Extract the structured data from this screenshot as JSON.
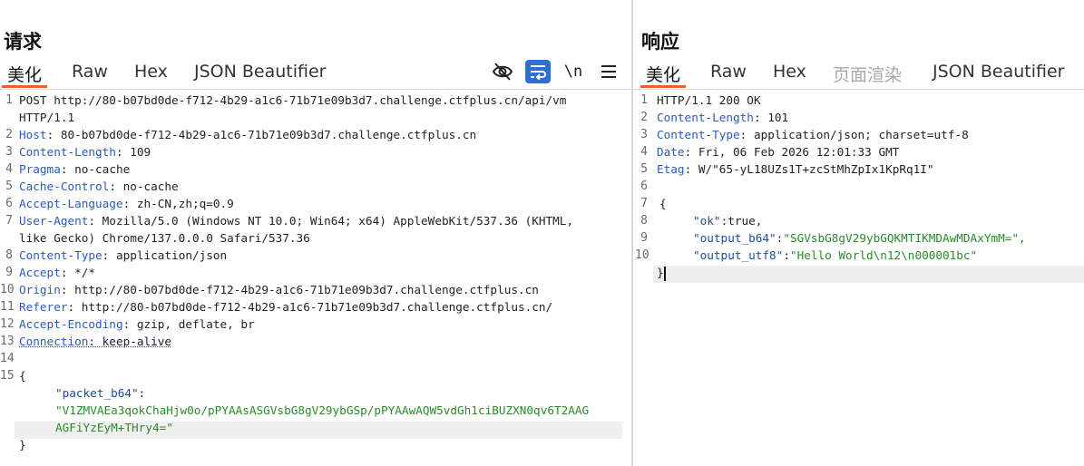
{
  "request": {
    "title": "请求",
    "tabs": [
      "美化",
      "Raw",
      "Hex",
      "JSON Beautifier"
    ],
    "active_tab": "美化",
    "toolbar": {
      "newline_label": "\\n"
    },
    "gutter": [
      "1",
      "2",
      "3",
      "4",
      "5",
      "6",
      "7",
      "8",
      "9",
      "10",
      "11",
      "12",
      "13",
      "14",
      "15"
    ],
    "lines": {
      "l1a": "POST http://80-b07bd0de-f712-4b29-a1c6-71b71e09b3d7.challenge.ctfplus.cn/api/vm",
      "l1b": "HTTP/1.1",
      "host_name": "Host",
      "host_value": " 80-b07bd0de-f712-4b29-a1c6-71b71e09b3d7.challenge.ctfplus.cn",
      "cl_name": "Content-Length",
      "cl_value": " 109",
      "pragma_name": "Pragma",
      "pragma_value": " no-cache",
      "cc_name": "Cache-Control",
      "cc_value": " no-cache",
      "al_name": "Accept-Language",
      "al_value": " zh-CN,zh;q=0.9",
      "ua_name": "User-Agent",
      "ua_value": " Mozilla/5.0 (Windows NT 10.0; Win64; x64) AppleWebKit/537.36 (KHTML,",
      "ua_value2": "like Gecko) Chrome/137.0.0.0 Safari/537.36",
      "ct_name": "Content-Type",
      "ct_value": " application/json",
      "accept_name": "Accept",
      "accept_value": " */*",
      "origin_name": "Origin",
      "origin_value": " http://80-b07bd0de-f712-4b29-a1c6-71b71e09b3d7.challenge.ctfplus.cn",
      "referer_name": "Referer",
      "referer_value": " http://80-b07bd0de-f712-4b29-a1c6-71b71e09b3d7.challenge.ctfplus.cn/",
      "ae_name": "Accept-Encoding",
      "ae_value": " gzip, deflate, br",
      "conn_name": "Connection",
      "conn_value": " keep-alive",
      "brace_open": "{",
      "json_key": "\"packet_b64\"",
      "json_colon": ":",
      "json_val1": "\"V1ZMVAEa3qokChaHjw0o/pPYAAsASGVsbG8gV29ybGSp/pPYAAwAQW5vdGh1ciBUZXN0qv6T2AAG",
      "json_val2": "AGFiYzEyM+THry4=\"",
      "brace_close": "}"
    }
  },
  "response": {
    "title": "响应",
    "tabs": [
      "美化",
      "Raw",
      "Hex",
      "页面渲染",
      "JSON Beautifier"
    ],
    "active_tab": "美化",
    "disabled_tab": "页面渲染",
    "gutter": [
      "1",
      "2",
      "3",
      "4",
      "5",
      "6",
      "7",
      "8",
      "9",
      "10"
    ],
    "lines": {
      "status": "HTTP/1.1 200 OK",
      "cl_name": "Content-Length",
      "cl_value": " 101",
      "ct_name": "Content-Type",
      "ct_value": " application/json; charset=utf-8",
      "date_name": "Date",
      "date_value": " Fri, 06 Feb 2026 12:01:33 GMT",
      "etag_name": "Etag",
      "etag_value": " W/\"65-yL18UZs1T+zcStMhZpIx1KpRq1I\"",
      "brace_open": "{",
      "ok_key": "\"ok\"",
      "ok_val": "true,",
      "b64_key": "\"output_b64\"",
      "b64_val": "\"SGVsbG8gV29ybGQKMTIKMDAwMDAxYmM=\",",
      "utf8_key": "\"output_utf8\"",
      "utf8_val": "\"Hello World\\n12\\n000001bc\"",
      "brace_close": "}"
    }
  }
}
